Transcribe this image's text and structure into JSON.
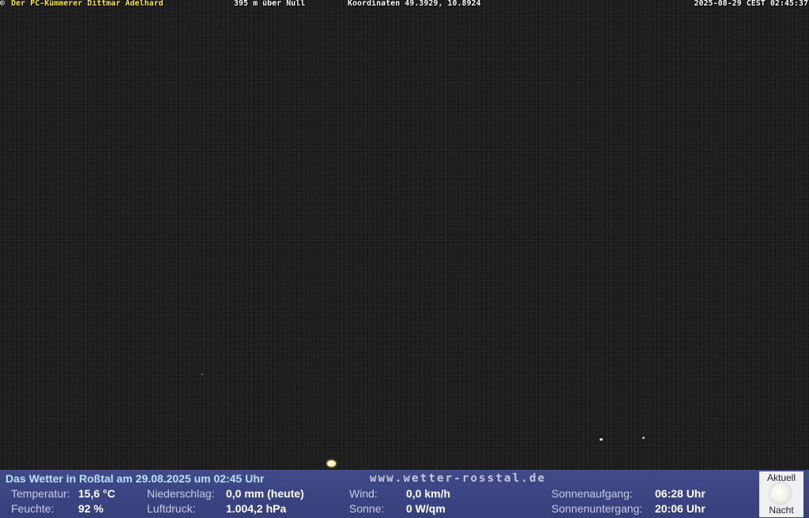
{
  "overlay": {
    "copyright_symbol": "©",
    "owner": "Der PC-Kümmerer Dittmar Adelhard",
    "altitude": "395 m über Null",
    "coordinates": "Koordinaten 49.3929, 10.8924",
    "datetime": "2025-08-29 CEST 02:45:37"
  },
  "weather": {
    "headline": "Das Wetter in Roßtal am 29.08.2025 um 02:45 Uhr",
    "website": "www.wetter-rosstal.de",
    "temperature": {
      "label": "Temperatur:",
      "value": "15,6 °C"
    },
    "humidity": {
      "label": "Feuchte:",
      "value": "92 %"
    },
    "precipitation": {
      "label": "Niederschlag:",
      "value": "0,0 mm (heute)"
    },
    "pressure": {
      "label": "Luftdruck:",
      "value": "1.004,2 hPa"
    },
    "wind": {
      "label": "Wind:",
      "value": "0,0 km/h"
    },
    "sun": {
      "label": "Sonne:",
      "value": "0 W/qm"
    },
    "sunrise": {
      "label": "Sonnenaufgang:",
      "value": "06:28 Uhr"
    },
    "sunset": {
      "label": "Sonnenuntergang:",
      "value": "20:06 Uhr"
    }
  },
  "moon_panel": {
    "top_caption": "Aktuell",
    "bottom_caption": "Nacht",
    "icon": "full-moon-icon"
  },
  "colors": {
    "owner_text": "#ffe83a",
    "panel_background": "#3b4482",
    "headline_text": "#b9e0ff"
  }
}
